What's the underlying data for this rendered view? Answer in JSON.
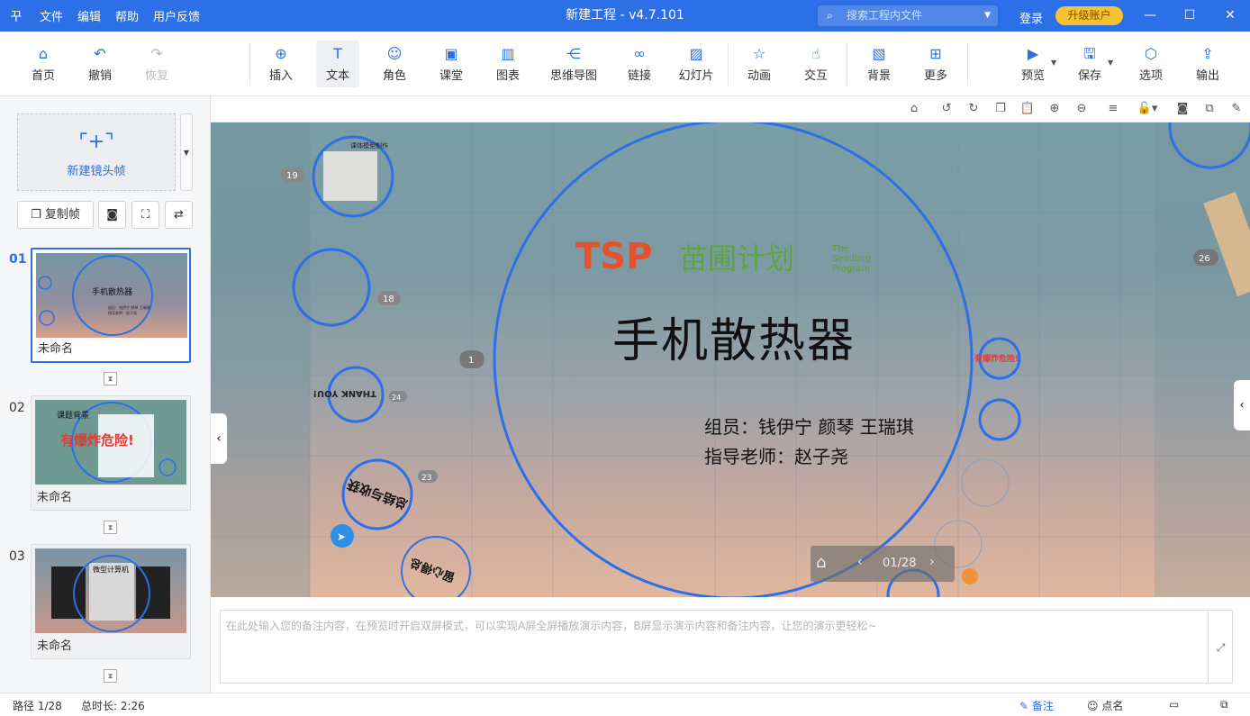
{
  "titlebar": {
    "logo": "꾸",
    "menu": [
      "文件",
      "编辑",
      "帮助",
      "用户反馈"
    ],
    "title": "新建工程 - v4.7.101",
    "search_placeholder": "搜索工程内文件",
    "login": "登录",
    "upgrade": "升级账户"
  },
  "toolbar": {
    "home": "首页",
    "undo": "撤销",
    "redo": "恢复",
    "insert": "插入",
    "text": "文本",
    "role": "角色",
    "class": "课堂",
    "chart": "图表",
    "mindmap": "思维导图",
    "link": "链接",
    "slides": "幻灯片",
    "animation": "动画",
    "interact": "交互",
    "background": "背景",
    "more": "更多",
    "preview": "预览",
    "save": "保存",
    "options": "选项",
    "export": "输出"
  },
  "sidebar": {
    "new_frame": "新建镜头帧",
    "copy_frame": "复制帧",
    "frames": [
      {
        "num": "01",
        "name": "未命名",
        "thumb_title": "手机散热器",
        "thumb_sub": "组员：钱伊宁 颜琴 王瑞琪\n指导老师：赵子尧"
      },
      {
        "num": "02",
        "name": "未命名",
        "thumb_title": "课题背景",
        "thumb_banner": "有爆炸危险!"
      },
      {
        "num": "03",
        "name": "未命名",
        "thumb_title": "微型计算机"
      }
    ]
  },
  "canvas": {
    "title": "手机散热器",
    "members": "组员：钱伊宁 颜琴 王瑞琪",
    "teacher": "指导老师：赵子尧",
    "logo_tsp": "TSP",
    "logo_cn": "苗圃计划",
    "logo_en1": "The",
    "logo_en2": "Seedling",
    "logo_en3": "Program",
    "nums": [
      "19",
      "18",
      "24",
      "23",
      "1",
      "26"
    ],
    "texts": {
      "thank": "THANK YOU!",
      "summary": "总结与收获",
      "xinde": "留心得总",
      "kaishu": "课体模型制作",
      "banner": "有爆炸危险!"
    },
    "nav": "01/28"
  },
  "notes": {
    "placeholder": "在此处输入您的备注内容，在预览时开启双屏模式，可以实现A屏全屏播放演示内容，B屏显示演示内容和备注内容，让您的演示更轻松~"
  },
  "status": {
    "path": "路径 1/28",
    "duration": "总时长: 2:26",
    "notes_btn": "备注",
    "rollcall": "点名"
  }
}
